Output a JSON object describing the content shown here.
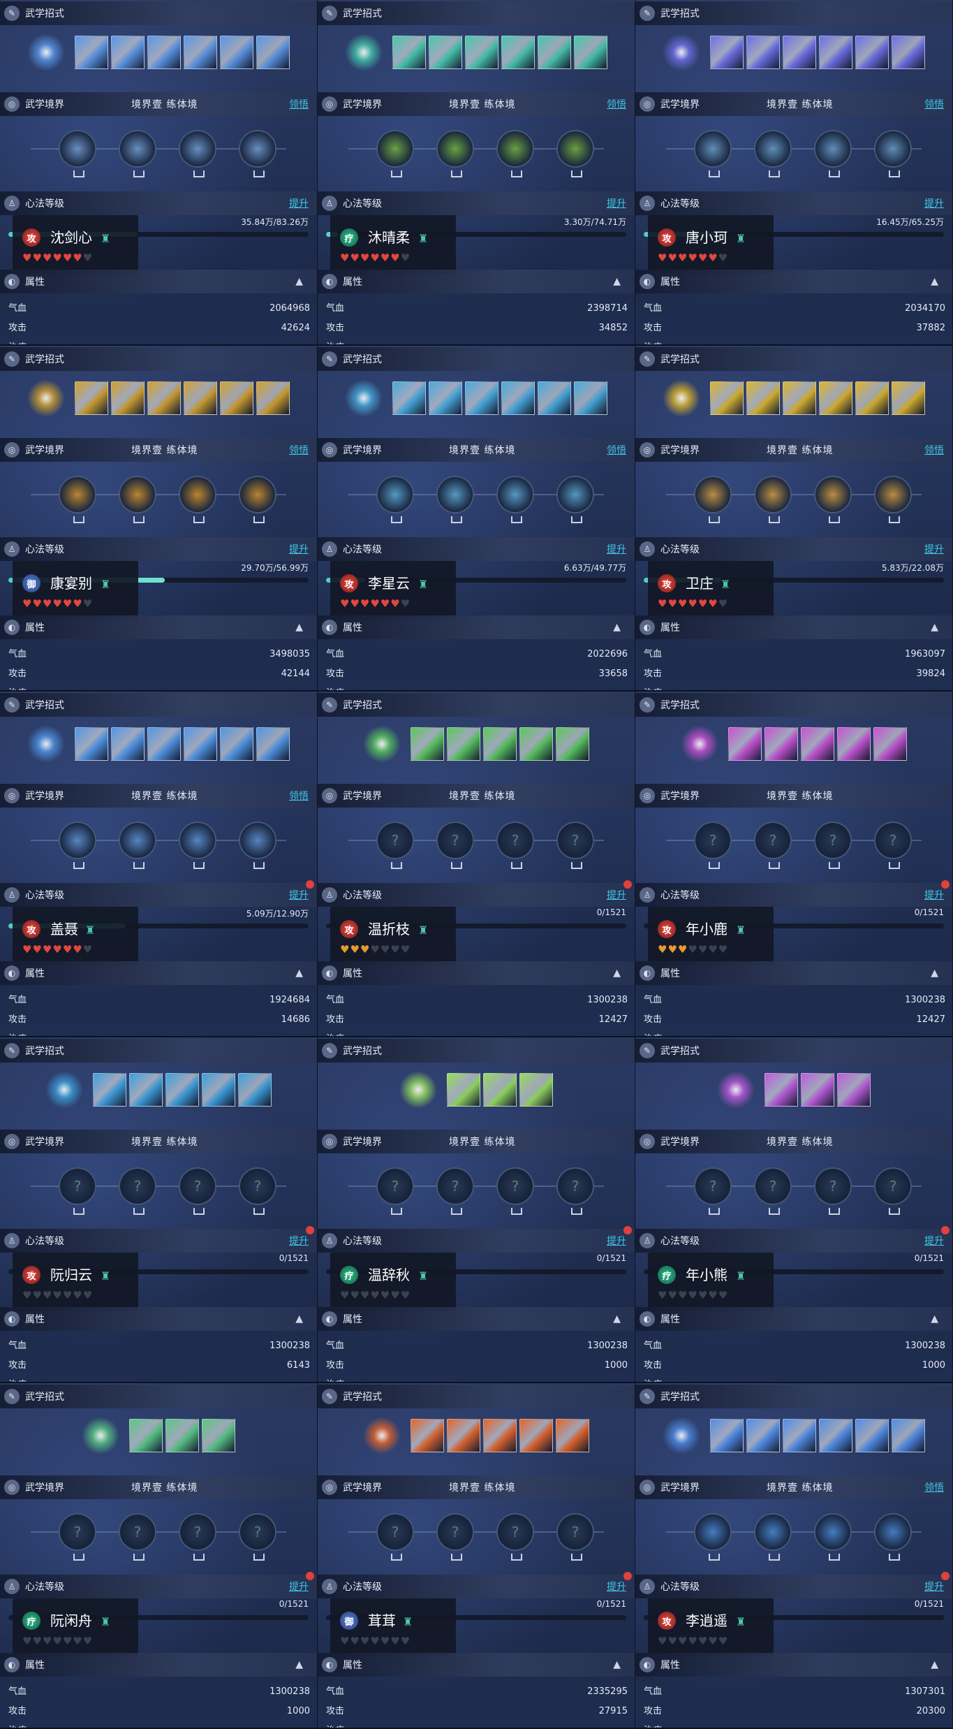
{
  "labels": {
    "skills": "武学招式",
    "realm": "武学境界",
    "realm_stages": "境界壹  练体境",
    "comprehend": "领悟",
    "mind": "心法等级",
    "upgrade": "提升",
    "attr": "属性",
    "hp": "气血",
    "atk": "攻击",
    "cut": "治疗"
  },
  "panels": [
    {
      "name": "沈剑心",
      "role": "攻",
      "role_type": "atk",
      "hearts": "red6",
      "xp_text": "35.84万/83.26万",
      "xp": 0.43,
      "hp": "2064968",
      "atk": "42624",
      "color": "90,150,230",
      "skills": 6,
      "realm_lit": true,
      "comprehend": true,
      "upgrade_dot": false,
      "node_color": "110,150,200"
    },
    {
      "name": "沐晴柔",
      "role": "疗",
      "role_type": "heal",
      "hearts": "red6",
      "xp_text": "3.30万/74.71万",
      "xp": 0.04,
      "hp": "2398714",
      "atk": "34852",
      "color": "70,200,170",
      "skills": 6,
      "realm_lit": true,
      "comprehend": true,
      "upgrade_dot": false,
      "node_color": "110,170,60"
    },
    {
      "name": "唐小珂",
      "role": "攻",
      "role_type": "atk",
      "hearts": "red6",
      "xp_text": "16.45万/65.25万",
      "xp": 0.25,
      "hp": "2034170",
      "atk": "37882",
      "color": "110,110,230",
      "skills": 6,
      "realm_lit": true,
      "comprehend": true,
      "upgrade_dot": false,
      "node_color": "100,150,190"
    },
    {
      "name": "康宴别",
      "role": "御",
      "role_type": "def",
      "hearts": "red6",
      "xp_text": "29.70万/56.99万",
      "xp": 0.52,
      "hp": "3498035",
      "atk": "42144",
      "color": "210,160,40",
      "skills": 6,
      "realm_lit": true,
      "comprehend": true,
      "upgrade_dot": false,
      "node_color": "200,140,40"
    },
    {
      "name": "李星云",
      "role": "攻",
      "role_type": "atk",
      "hearts": "red6",
      "xp_text": "6.63万/49.77万",
      "xp": 0.13,
      "hp": "2022696",
      "atk": "33658",
      "color": "70,170,220",
      "skills": 6,
      "realm_lit": true,
      "comprehend": true,
      "upgrade_dot": false,
      "node_color": "90,160,200"
    },
    {
      "name": "卫庄",
      "role": "攻",
      "role_type": "atk",
      "hearts": "red6",
      "xp_text": "5.83万/22.08万",
      "xp": 0.26,
      "hp": "1963097",
      "atk": "39824",
      "color": "220,180,40",
      "skills": 6,
      "realm_lit": true,
      "comprehend": true,
      "upgrade_dot": false,
      "node_color": "200,150,60"
    },
    {
      "name": "盖聂",
      "role": "攻",
      "role_type": "atk",
      "hearts": "red6",
      "xp_text": "5.09万/12.90万",
      "xp": 0.39,
      "hp": "1924684",
      "atk": "14686",
      "color": "80,150,230",
      "skills": 6,
      "realm_lit": true,
      "comprehend": true,
      "upgrade_dot": true,
      "node_color": "90,140,200"
    },
    {
      "name": "温折枝",
      "role": "攻",
      "role_type": "atk",
      "hearts": "gold3",
      "xp_text": "0/1521",
      "xp": 0,
      "hp": "1300238",
      "atk": "12427",
      "color": "90,200,90",
      "skills": 5,
      "realm_lit": false,
      "comprehend": false,
      "upgrade_dot": true,
      "node_color": "80,120,120"
    },
    {
      "name": "年小鹿",
      "role": "攻",
      "role_type": "atk",
      "hearts": "gold3",
      "xp_text": "0/1521",
      "xp": 0,
      "hp": "1300238",
      "atk": "12427",
      "color": "200,80,210",
      "skills": 5,
      "realm_lit": false,
      "comprehend": false,
      "upgrade_dot": true,
      "node_color": "80,120,120"
    },
    {
      "name": "阮归云",
      "role": "攻",
      "role_type": "atk",
      "hearts": "off",
      "xp_text": "0/1521",
      "xp": 0,
      "hp": "1300238",
      "atk": "6143",
      "color": "60,160,220",
      "skills": 5,
      "realm_lit": false,
      "comprehend": false,
      "upgrade_dot": true,
      "node_color": "80,120,120"
    },
    {
      "name": "温辞秋",
      "role": "疗",
      "role_type": "heal",
      "hearts": "off",
      "xp_text": "0/1521",
      "xp": 0,
      "hp": "1300238",
      "atk": "1000",
      "color": "150,220,90",
      "skills": 3,
      "realm_lit": false,
      "comprehend": false,
      "upgrade_dot": true,
      "node_color": "80,120,120"
    },
    {
      "name": "年小熊",
      "role": "疗",
      "role_type": "heal",
      "hearts": "off",
      "xp_text": "0/1521",
      "xp": 0,
      "hp": "1300238",
      "atk": "1000",
      "color": "190,90,220",
      "skills": 3,
      "realm_lit": false,
      "comprehend": false,
      "upgrade_dot": true,
      "node_color": "80,120,120"
    },
    {
      "name": "阮闲舟",
      "role": "疗",
      "role_type": "heal",
      "hearts": "off",
      "xp_text": "0/1521",
      "xp": 0,
      "hp": "1300238",
      "atk": "1000",
      "color": "90,200,130",
      "skills": 3,
      "realm_lit": false,
      "comprehend": false,
      "upgrade_dot": true,
      "node_color": "80,120,120"
    },
    {
      "name": "茸茸",
      "role": "御",
      "role_type": "def",
      "hearts": "off",
      "xp_text": "0/1521",
      "xp": 0,
      "hp": "2335295",
      "atk": "27915",
      "color": "230,100,40",
      "skills": 5,
      "realm_lit": false,
      "comprehend": false,
      "upgrade_dot": true,
      "node_color": "80,120,120"
    },
    {
      "name": "李逍遥",
      "role": "攻",
      "role_type": "atk",
      "hearts": "off",
      "xp_text": "0/1521",
      "xp": 0,
      "hp": "1307301",
      "atk": "20300",
      "color": "80,140,230",
      "skills": 6,
      "realm_lit": true,
      "comprehend": true,
      "upgrade_dot": true,
      "node_color": "70,130,200"
    }
  ]
}
